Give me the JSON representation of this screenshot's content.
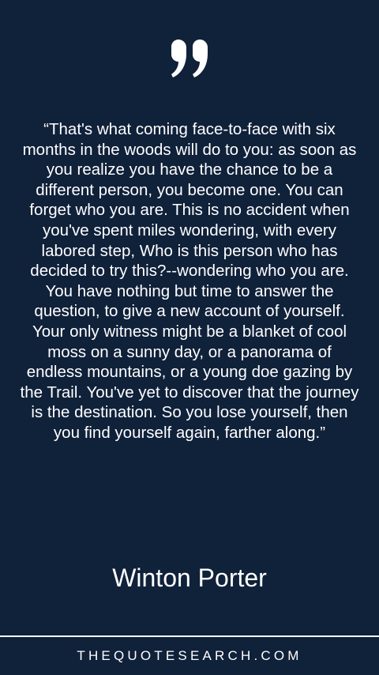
{
  "icon": {
    "name": "closing-quote-icon",
    "color": "#ffffff"
  },
  "quote": {
    "text": "“That's what coming face-to-face with six months in the woods will do to you: as soon as you realize you have the chance to be a different person, you become one. You can forget who you are. This is no accident when you've spent miles wondering, with every labored step, Who is this person who has decided to try this?--wondering who you are. You have nothing but time to answer the question, to give a new account of yourself. Your only witness might be a blanket of cool moss on a sunny day, or a panorama of endless mountains, or a young doe gazing by the Trail. You've yet to discover that the journey is the destination. So you lose yourself, then you find yourself again, farther along.”"
  },
  "author": {
    "name": "Winton Porter"
  },
  "footer": {
    "site": "THEQUOTESEARCH.COM"
  },
  "colors": {
    "background": "#10213a",
    "text": "#ffffff"
  }
}
